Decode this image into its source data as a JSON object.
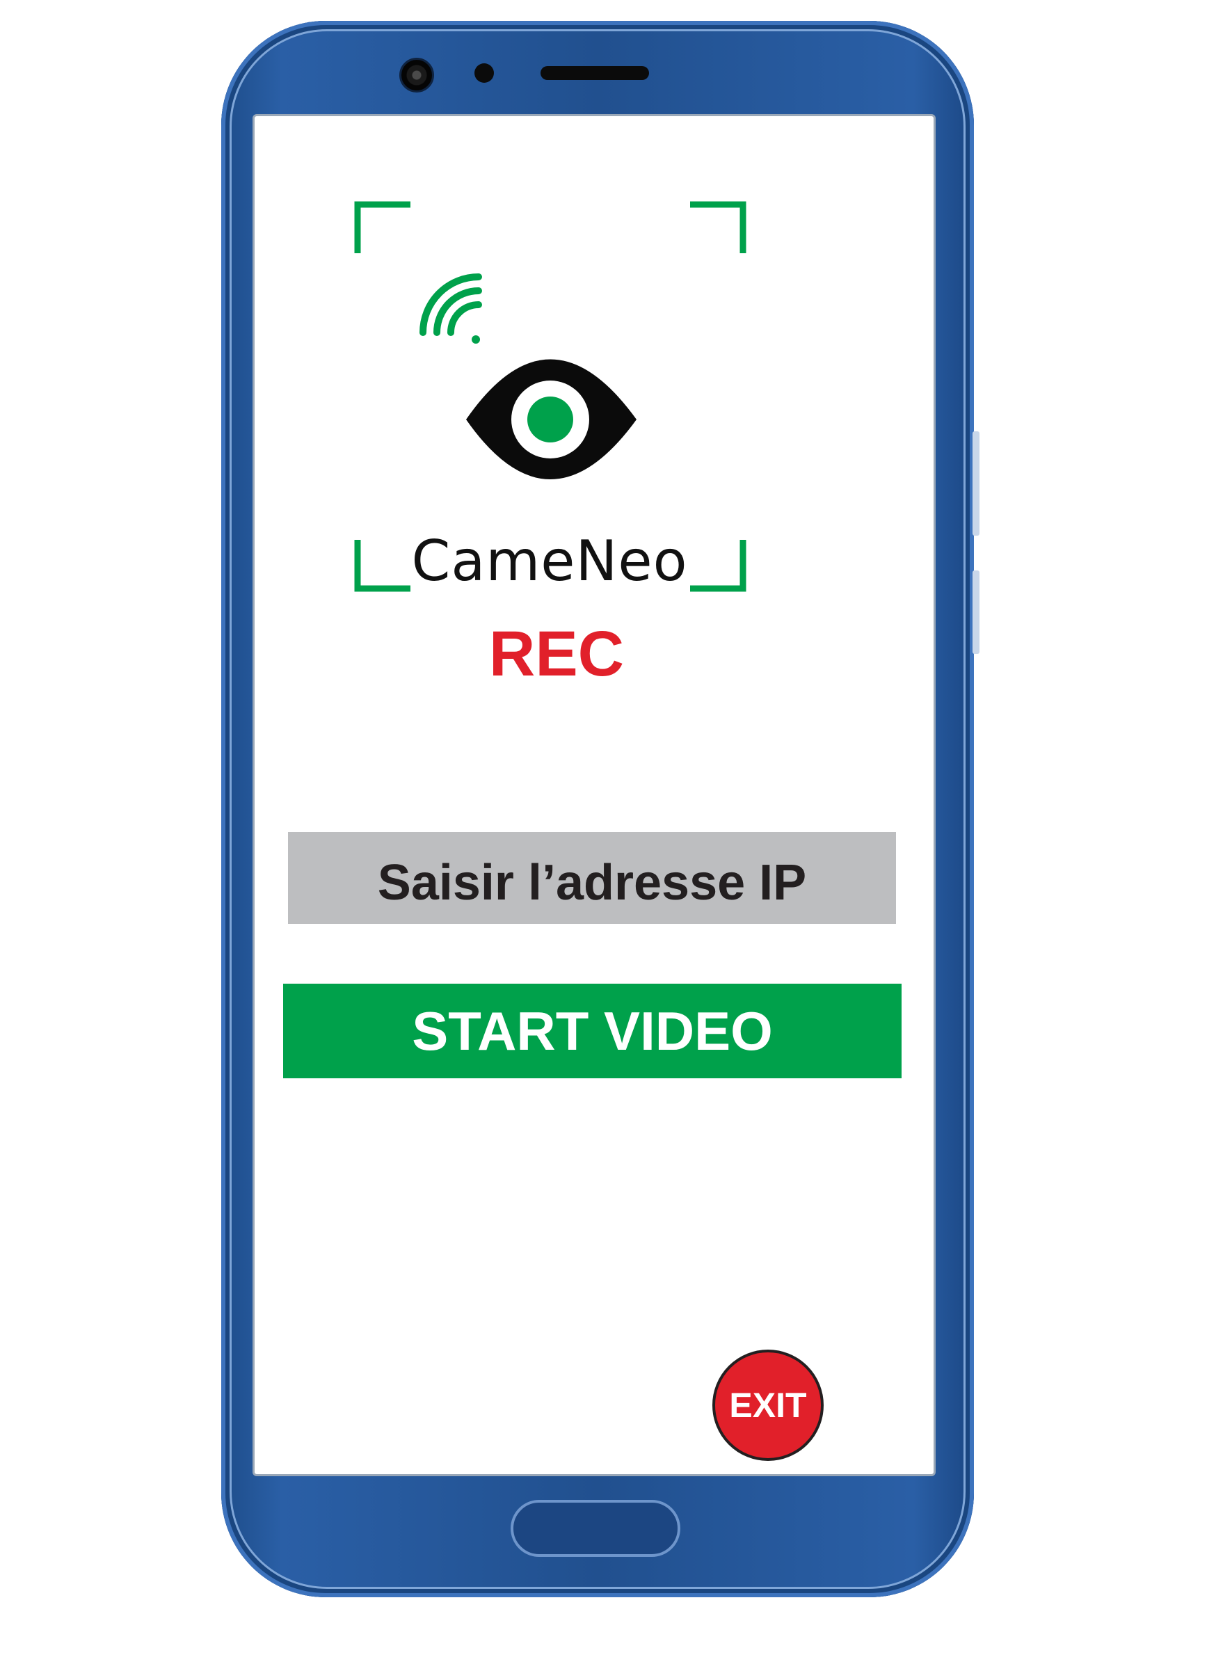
{
  "app": {
    "logo_text": "CameNeo",
    "status_label": "REC"
  },
  "ip_field": {
    "placeholder": "Saisir l’adresse IP",
    "value": ""
  },
  "actions": {
    "start_label": "START VIDEO",
    "exit_label": "EXIT"
  },
  "colors": {
    "accent_green": "#00a14b",
    "rec_red": "#e1202a",
    "input_gray": "#bdbec0",
    "phone_blue": "#21508f"
  },
  "icons": [
    "wifi-icon",
    "eye-icon"
  ]
}
